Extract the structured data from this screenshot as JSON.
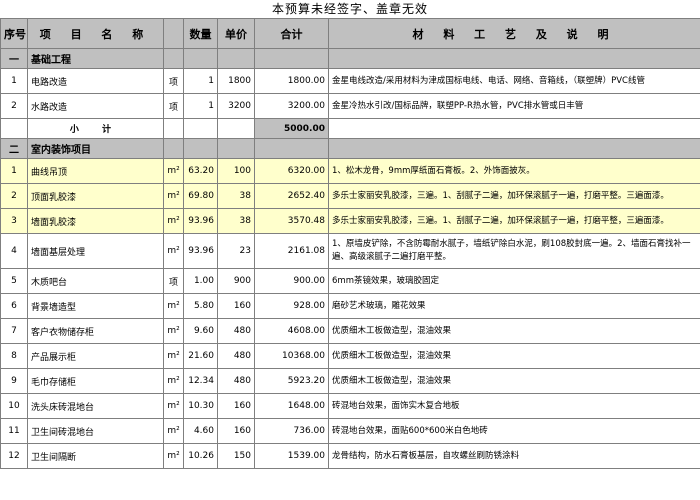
{
  "notice": "本预算未经签字、盖章无效",
  "headers": {
    "seq": "序号",
    "item": "项 目 名 称",
    "unit": "",
    "qty": "数量",
    "price": "单价",
    "total": "合计",
    "desc": "材  料  工  艺  及  说  明"
  },
  "sections": [
    {
      "no": "一",
      "title": "基础工程",
      "rows": [
        {
          "no": "1",
          "name": "电路改造",
          "unit": "项",
          "qty": "1",
          "price": "1800",
          "total": "1800.00",
          "desc": "金星电线改造/采用材料为津成国标电线、电话、网络、音箱线，（联塑牌）PVC线管",
          "hl": false
        },
        {
          "no": "2",
          "name": "水路改造",
          "unit": "项",
          "qty": "1",
          "price": "3200",
          "total": "3200.00",
          "desc": "金星冷热水引改/国标品牌，联塑PP-R热水管，PVC排水管或日丰管",
          "hl": false
        }
      ],
      "subtotal": {
        "label": "小  计",
        "value": "5000.00"
      }
    },
    {
      "no": "二",
      "title": "室内装饰项目",
      "rows": [
        {
          "no": "1",
          "name": "曲线吊顶",
          "unit": "m²",
          "qty": "63.20",
          "price": "100",
          "total": "6320.00",
          "desc": "1、松木龙骨，9mm厚纸面石膏板。2、外饰面披灰。",
          "hl": true
        },
        {
          "no": "2",
          "name": "顶面乳胶漆",
          "unit": "m²",
          "qty": "69.80",
          "price": "38",
          "total": "2652.40",
          "desc": "多乐士家丽安乳胶漆，三遍。1、刮腻子二遍，加环保滚腻子一遍，打磨平整。三遍面漆。",
          "hl": true
        },
        {
          "no": "3",
          "name": "墙面乳胶漆",
          "unit": "m²",
          "qty": "93.96",
          "price": "38",
          "total": "3570.48",
          "desc": "多乐士家丽安乳胶漆，三遍。1、刮腻子二遍，加环保滚腻子一遍，打磨平整，三遍面漆。",
          "hl": true
        },
        {
          "no": "4",
          "name": "墙面基层处理",
          "unit": "m²",
          "qty": "93.96",
          "price": "23",
          "total": "2161.08",
          "desc": "1、原墙皮铲除，不含防霉耐水腻子，墙纸铲除白水泥，刷108胶封底一遍。2、墙面石膏找补一遍、高级滚腻子二遍打磨平整。",
          "hl": false
        },
        {
          "no": "5",
          "name": "木质吧台",
          "unit": "项",
          "qty": "1.00",
          "price": "900",
          "total": "900.00",
          "desc": "6mm茶镜效果，玻璃胶固定",
          "hl": false
        },
        {
          "no": "6",
          "name": "背景墙造型",
          "unit": "m²",
          "qty": "5.80",
          "price": "160",
          "total": "928.00",
          "desc": "磨砂艺术玻璃，雕花效果",
          "hl": false
        },
        {
          "no": "7",
          "name": "客户衣物储存柜",
          "unit": "m²",
          "qty": "9.60",
          "price": "480",
          "total": "4608.00",
          "desc": "优质细木工板做造型，混油效果",
          "hl": false
        },
        {
          "no": "8",
          "name": "产品展示柜",
          "unit": "m²",
          "qty": "21.60",
          "price": "480",
          "total": "10368.00",
          "desc": "优质细木工板做造型，混油效果",
          "hl": false
        },
        {
          "no": "9",
          "name": "毛巾存储柜",
          "unit": "m²",
          "qty": "12.34",
          "price": "480",
          "total": "5923.20",
          "desc": "优质细木工板做造型，混油效果",
          "hl": false
        },
        {
          "no": "10",
          "name": "洗头床砖混地台",
          "unit": "m²",
          "qty": "10.30",
          "price": "160",
          "total": "1648.00",
          "desc": "砖混地台效果，面饰实木复合地板",
          "hl": false
        },
        {
          "no": "11",
          "name": "卫生间砖混地台",
          "unit": "m²",
          "qty": "4.60",
          "price": "160",
          "total": "736.00",
          "desc": "砖混地台效果，面贴600*600米白色地砖",
          "hl": false
        },
        {
          "no": "12",
          "name": "卫生间隔断",
          "unit": "m²",
          "qty": "10.26",
          "price": "150",
          "total": "1539.00",
          "desc": "龙骨结构，防水石膏板基层，自攻螺丝刷防锈涂料",
          "hl": false
        }
      ]
    }
  ]
}
